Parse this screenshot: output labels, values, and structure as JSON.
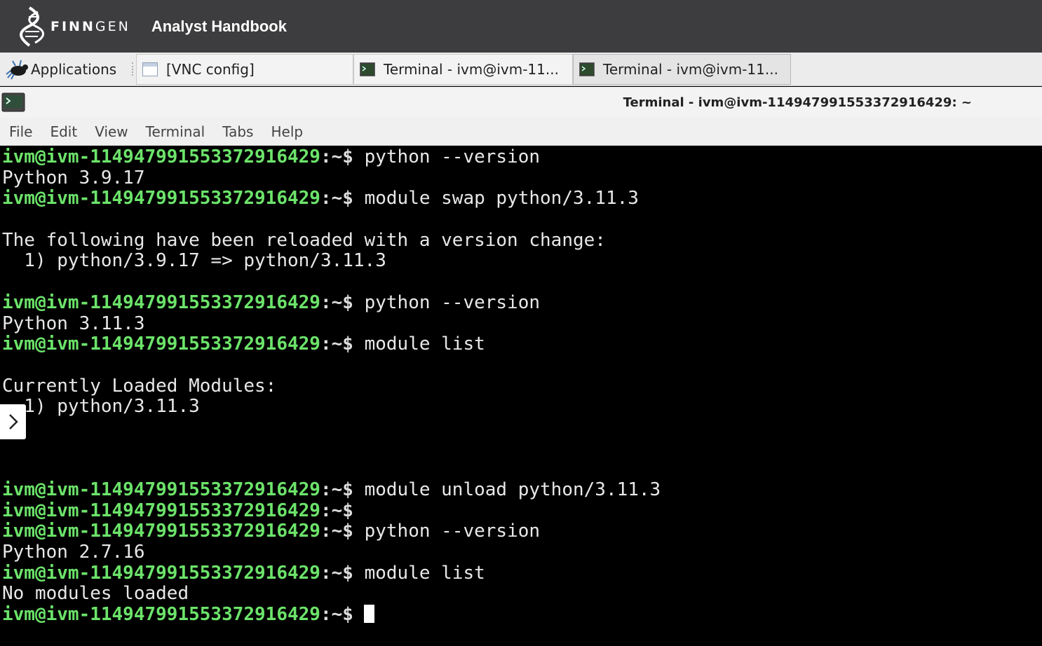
{
  "header": {
    "logo_bold": "FINN",
    "logo_light": "GEN",
    "site_title": "Analyst Handbook"
  },
  "taskbar": {
    "applications_label": "Applications",
    "tasks": [
      {
        "label": "[VNC config]",
        "icon": "window-icon"
      },
      {
        "label": "Terminal - ivm@ivm-11...",
        "icon": "terminal-icon"
      },
      {
        "label": "Terminal - ivm@ivm-11...",
        "icon": "terminal-icon"
      }
    ]
  },
  "window": {
    "title": "Terminal - ivm@ivm-1149479915533729​16429: ~"
  },
  "menu": [
    "File",
    "Edit",
    "View",
    "Terminal",
    "Tabs",
    "Help"
  ],
  "terminal": {
    "prompt": "ivm@ivm-114947991553372916429",
    "prompt_suffix": ":~$",
    "lines": [
      {
        "type": "cmd",
        "text": " python --version"
      },
      {
        "type": "out",
        "text": "Python 3.9.17"
      },
      {
        "type": "cmd",
        "text": " module swap python/3.11.3"
      },
      {
        "type": "out",
        "text": ""
      },
      {
        "type": "out",
        "text": "The following have been reloaded with a version change:"
      },
      {
        "type": "out",
        "text": "  1) python/3.9.17 => python/3.11.3"
      },
      {
        "type": "out",
        "text": ""
      },
      {
        "type": "cmd",
        "text": " python --version"
      },
      {
        "type": "out",
        "text": "Python 3.11.3"
      },
      {
        "type": "cmd",
        "text": " module list"
      },
      {
        "type": "out",
        "text": ""
      },
      {
        "type": "out",
        "text": "Currently Loaded Modules:"
      },
      {
        "type": "out",
        "text": "  1) python/3.11.3"
      },
      {
        "type": "out",
        "text": ""
      },
      {
        "type": "out",
        "text": ""
      },
      {
        "type": "out",
        "text": ""
      },
      {
        "type": "cmd",
        "text": " module unload python/3.11.3"
      },
      {
        "type": "cmd",
        "text": ""
      },
      {
        "type": "cmd",
        "text": " python --version"
      },
      {
        "type": "out",
        "text": "Python 2.7.16"
      },
      {
        "type": "cmd",
        "text": " module list"
      },
      {
        "type": "out",
        "text": "No modules loaded"
      },
      {
        "type": "cmd_cursor",
        "text": ""
      }
    ]
  },
  "colors": {
    "header_bg": "#3d3d3f",
    "prompt_green": "#6ce36a",
    "terminal_bg": "#000000"
  }
}
